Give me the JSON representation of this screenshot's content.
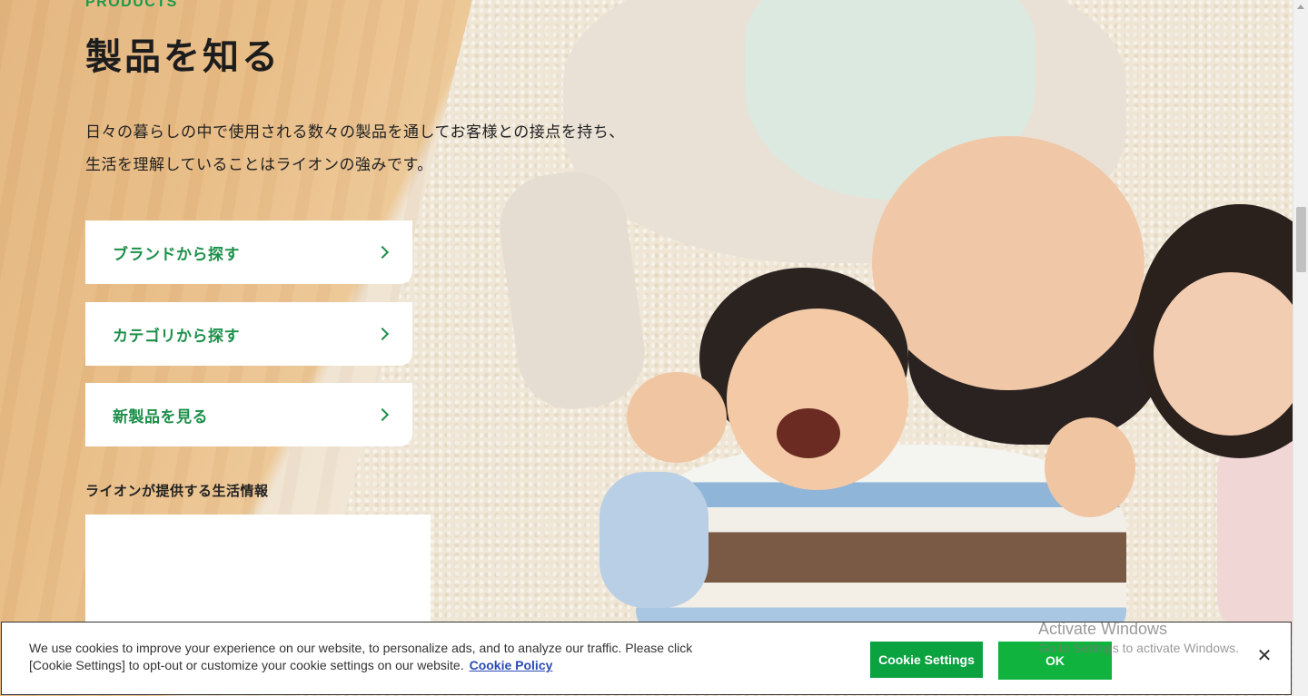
{
  "section": {
    "eyebrow": "PRODUCTS",
    "title": "製品を知る",
    "description_lines": [
      "日々の暮らしの中で使用される数々の製品を通してお客様との接点を持ち、",
      "生活を理解していることはライオンの強みです。"
    ]
  },
  "links": [
    {
      "label": "ブランドから探す",
      "icon": "chevron-right-icon"
    },
    {
      "label": "カテゴリから探す",
      "icon": "chevron-right-icon"
    },
    {
      "label": "新製品を見る",
      "icon": "chevron-right-icon"
    }
  ],
  "info": {
    "subheading": "ライオンが提供する生活情報"
  },
  "cookie_banner": {
    "text": "We use cookies to improve your experience on our website, to personalize ads, and to analyze our traffic. Please click [Cookie Settings] to opt-out or customize your cookie settings on our website.",
    "policy_link": "Cookie Policy",
    "settings_button": "Cookie Settings",
    "ok_button": "OK",
    "close_icon": "close-icon",
    "close_glyph": "✕"
  },
  "watermark": {
    "line1": "Activate Windows",
    "line2": "Go to Settings to activate Windows."
  },
  "colors": {
    "accent_green": "#1d8f4a",
    "button_green": "#10b33d"
  }
}
